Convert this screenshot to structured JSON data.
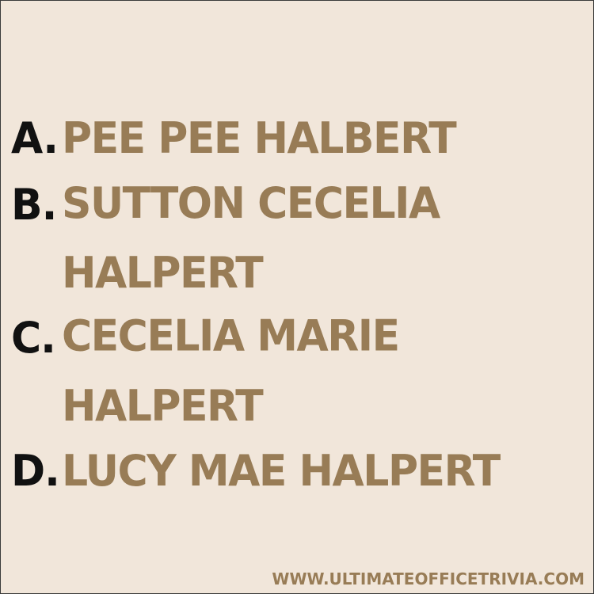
{
  "options": [
    {
      "letter": "A.",
      "lines": [
        "PEE PEE HALBERT"
      ]
    },
    {
      "letter": "B.",
      "lines": [
        "SUTTON CECELIA",
        "HALPERT"
      ]
    },
    {
      "letter": "C.",
      "lines": [
        "CECELIA MARIE",
        "HALPERT"
      ]
    },
    {
      "letter": "D.",
      "lines": [
        "LUCY MAE HALPERT"
      ]
    }
  ],
  "footer": {
    "url": "WWW.ULTIMATEOFFICETRIVIA.COM"
  },
  "colors": {
    "background": "#f1e6da",
    "letter": "#111111",
    "answer": "#987c56"
  }
}
